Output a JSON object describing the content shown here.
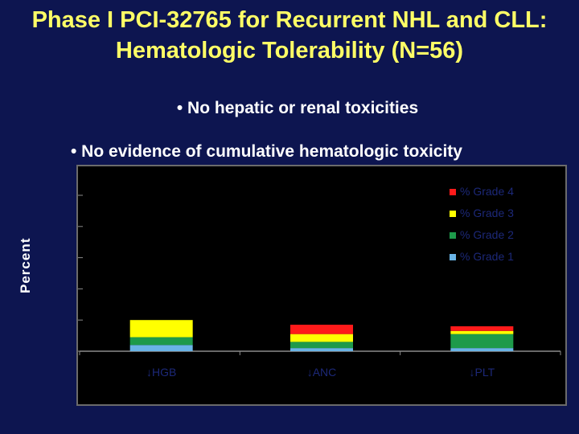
{
  "slide": {
    "title_line1": "Phase I PCI-32765 for Recurrent NHL and CLL:",
    "title_line2": "Hematologic Tolerability (N=56)",
    "bullet1": "• No hepatic or renal toxicities",
    "bullet2": "• No evidence of cumulative hematologic toxicity"
  },
  "colors": {
    "background": "#0d1550",
    "title": "#ffff66",
    "grade1": "#6ab4e6",
    "grade2": "#1e9a4a",
    "grade3": "#ffff00",
    "grade4": "#ff1a1a"
  },
  "chart_data": {
    "type": "bar",
    "stacked": true,
    "categories": [
      "↓HGB",
      "↓ANC",
      "↓PLT"
    ],
    "series": [
      {
        "name": "% Grade 1",
        "color": "#6ab4e6",
        "values": [
          4,
          2,
          2
        ]
      },
      {
        "name": "% Grade 2",
        "color": "#1e9a4a",
        "values": [
          5,
          4,
          9
        ]
      },
      {
        "name": "% Grade 3",
        "color": "#ffff00",
        "values": [
          11,
          5,
          2
        ]
      },
      {
        "name": "% Grade 4",
        "color": "#ff1a1a",
        "values": [
          0,
          6,
          3
        ]
      }
    ],
    "ylabel": "Percent",
    "ylim": [
      0,
      100
    ],
    "legend_position": "top-right",
    "grid": false
  }
}
